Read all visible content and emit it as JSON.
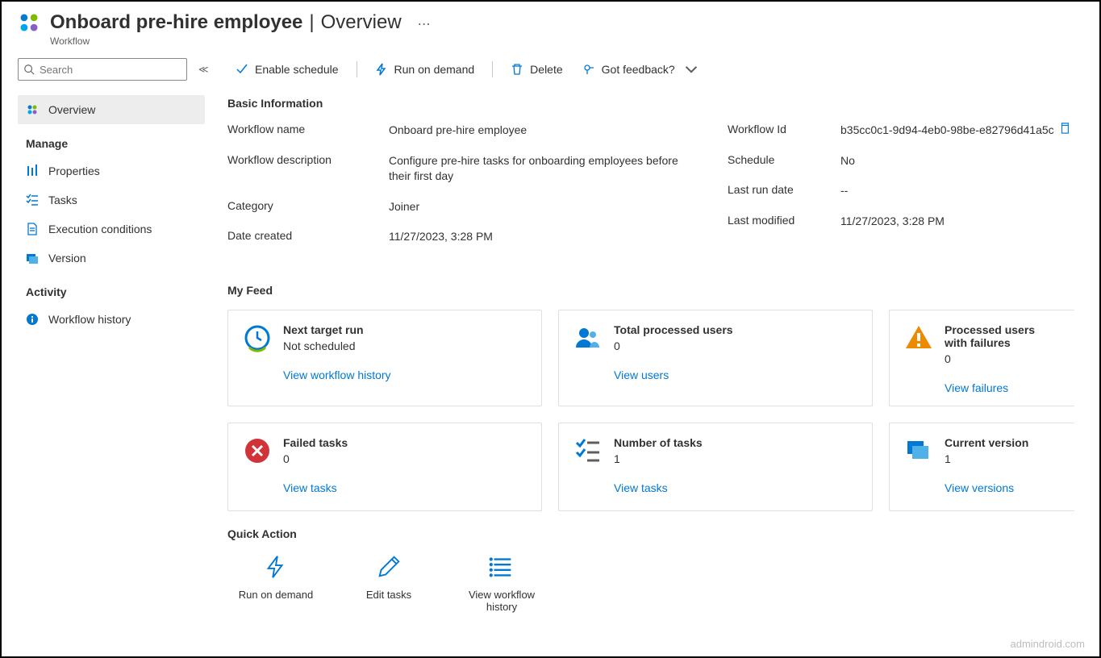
{
  "header": {
    "title": "Onboard pre-hire employee",
    "subtitle_suffix": "Overview",
    "type_label": "Workflow"
  },
  "sidebar": {
    "search_placeholder": "Search",
    "overview_label": "Overview",
    "manage_group": "Manage",
    "properties_label": "Properties",
    "tasks_label": "Tasks",
    "exec_cond_label": "Execution conditions",
    "version_label": "Version",
    "activity_group": "Activity",
    "workflow_history_label": "Workflow history"
  },
  "toolbar": {
    "enable_schedule": "Enable schedule",
    "run_on_demand": "Run on demand",
    "delete": "Delete",
    "got_feedback": "Got feedback?"
  },
  "sections": {
    "basic_info": "Basic Information",
    "my_feed": "My Feed",
    "quick_action": "Quick Action"
  },
  "info": {
    "workflow_name_label": "Workflow name",
    "workflow_name_value": "Onboard pre-hire employee",
    "workflow_desc_label": "Workflow description",
    "workflow_desc_value": "Configure pre-hire tasks for onboarding employees before their first day",
    "category_label": "Category",
    "category_value": "Joiner",
    "date_created_label": "Date created",
    "date_created_value": "11/27/2023, 3:28 PM",
    "workflow_id_label": "Workflow Id",
    "workflow_id_value": "b35cc0c1-9d94-4eb0-98be-e82796d41a5c",
    "schedule_label": "Schedule",
    "schedule_value": "No",
    "last_run_label": "Last run date",
    "last_run_value": "--",
    "last_modified_label": "Last modified",
    "last_modified_value": "11/27/2023, 3:28 PM"
  },
  "cards": {
    "next_target_run_title": "Next target run",
    "next_target_run_value": "Not scheduled",
    "next_target_run_link": "View workflow history",
    "total_processed_title": "Total processed users",
    "total_processed_value": "0",
    "total_processed_link": "View users",
    "processed_failures_title": "Processed users with failures",
    "processed_failures_value": "0",
    "processed_failures_link": "View failures",
    "failed_tasks_title": "Failed tasks",
    "failed_tasks_value": "0",
    "failed_tasks_link": "View tasks",
    "num_tasks_title": "Number of tasks",
    "num_tasks_value": "1",
    "num_tasks_link": "View tasks",
    "current_version_title": "Current version",
    "current_version_value": "1",
    "current_version_link": "View versions"
  },
  "quick_actions": {
    "run_on_demand": "Run on demand",
    "edit_tasks": "Edit tasks",
    "view_history": "View workflow history"
  },
  "watermark": "admindroid.com"
}
